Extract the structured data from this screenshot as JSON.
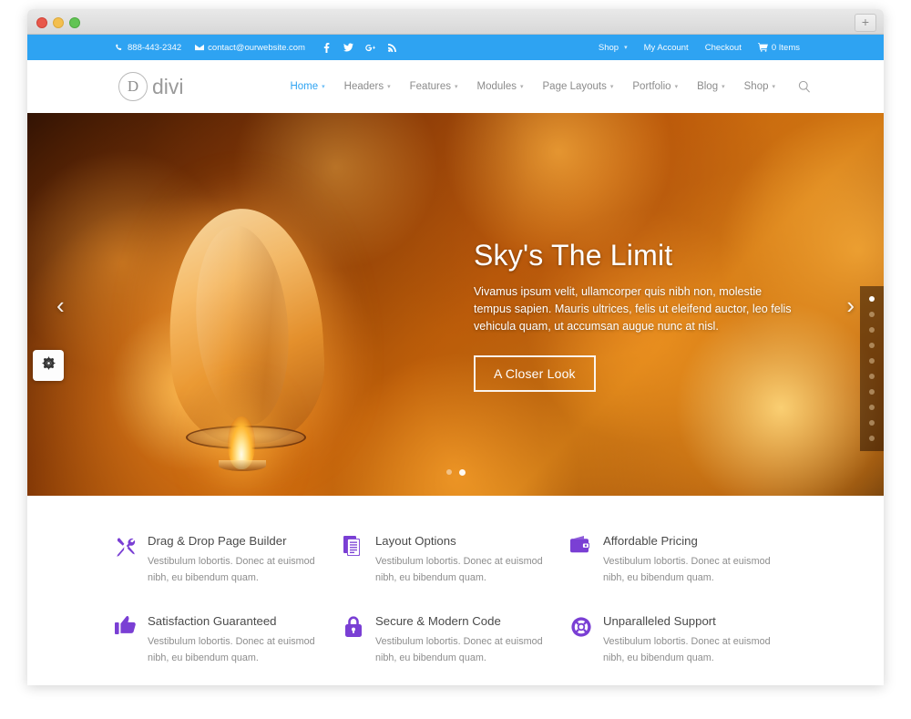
{
  "browser": {
    "new_tab_label": "+",
    "traffic_lights": [
      "close",
      "minimize",
      "zoom"
    ]
  },
  "topbar": {
    "phone": "888-443-2342",
    "email": "contact@ourwebsite.com",
    "social": [
      "facebook-icon",
      "twitter-icon",
      "google-plus-icon",
      "rss-icon"
    ],
    "links": [
      {
        "label": "Shop",
        "caret": "▾"
      },
      {
        "label": "My Account",
        "caret": ""
      },
      {
        "label": "Checkout",
        "caret": ""
      }
    ],
    "cart": {
      "icon": "cart-icon",
      "label": "0 Items"
    },
    "background_color": "#2ea3f2"
  },
  "header": {
    "logo": {
      "mark": "D",
      "text": "divi"
    },
    "nav": [
      {
        "label": "Home",
        "caret": "▾",
        "active": true
      },
      {
        "label": "Headers",
        "caret": "▾",
        "active": false
      },
      {
        "label": "Features",
        "caret": "▾",
        "active": false
      },
      {
        "label": "Modules",
        "caret": "▾",
        "active": false
      },
      {
        "label": "Page Layouts",
        "caret": "▾",
        "active": false
      },
      {
        "label": "Portfolio",
        "caret": "▾",
        "active": false
      },
      {
        "label": "Blog",
        "caret": "▾",
        "active": false
      },
      {
        "label": "Shop",
        "caret": "▾",
        "active": false
      }
    ],
    "search_icon": "search-icon",
    "active_color": "#2ea3f2"
  },
  "hero": {
    "title": "Sky's The Limit",
    "description": "Vivamus ipsum velit, ullamcorper quis nibh non, molestie tempus sapien. Mauris ultrices, felis ut eleifend auctor, leo felis vehicula quam, ut accumsan augue nunc at nisl.",
    "button_label": "A Closer Look",
    "prev_arrow": "‹",
    "next_arrow": "›",
    "slide_dots": 2,
    "active_slide": 2,
    "side_dots": 10,
    "active_side_dot": 1,
    "gear_icon": "gear-icon"
  },
  "features": {
    "body_text": "Vestibulum lobortis. Donec at euismod nibh, eu bibendum quam.",
    "items": [
      {
        "icon": "tools-icon",
        "title": "Drag & Drop Page Builder",
        "text": "Vestibulum lobortis. Donec at euismod nibh, eu bibendum quam."
      },
      {
        "icon": "documents-icon",
        "title": "Layout Options",
        "text": "Vestibulum lobortis. Donec at euismod nibh, eu bibendum quam."
      },
      {
        "icon": "wallet-icon",
        "title": "Affordable Pricing",
        "text": "Vestibulum lobortis. Donec at euismod nibh, eu bibendum quam."
      },
      {
        "icon": "thumbs-up-icon",
        "title": "Satisfaction Guaranteed",
        "text": "Vestibulum lobortis. Donec at euismod nibh, eu bibendum quam."
      },
      {
        "icon": "lock-icon",
        "title": "Secure & Modern Code",
        "text": "Vestibulum lobortis. Donec at euismod nibh, eu bibendum quam."
      },
      {
        "icon": "lifebuoy-icon",
        "title": "Unparalleled Support",
        "text": "Vestibulum lobortis. Donec at euismod nibh, eu bibendum quam."
      }
    ],
    "icon_color": "#7a3fd4"
  }
}
